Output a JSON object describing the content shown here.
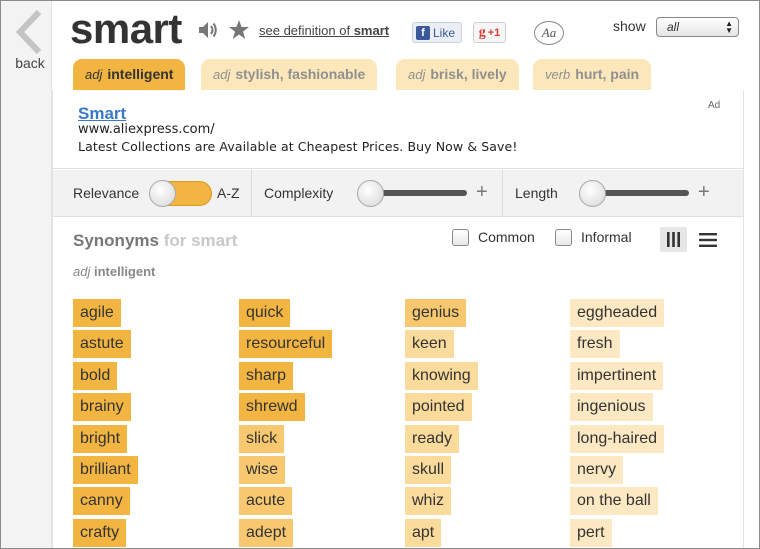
{
  "nav": {
    "back_label": "back"
  },
  "header": {
    "word": "smart",
    "see_definition_prefix": "see definition of",
    "see_definition_word": "smart",
    "fb_like": "Like",
    "gplus": "+1",
    "font_icon_label": "Aa",
    "show_label": "show",
    "show_value": "all"
  },
  "tabs": [
    {
      "pos": "adj",
      "label": "intelligent",
      "active": true
    },
    {
      "pos": "adj",
      "label": "stylish, fashionable",
      "active": false
    },
    {
      "pos": "adj",
      "label": "brisk, lively",
      "active": false
    },
    {
      "pos": "verb",
      "label": "hurt, pain",
      "active": false
    }
  ],
  "ad": {
    "title": "Smart",
    "url": "www.aliexpress.com/",
    "description": "Latest Collections are Available at Cheapest Prices. Buy Now & Save!",
    "badge": "Ad"
  },
  "filters": {
    "relevance": "Relevance",
    "az": "A-Z",
    "complexity": "Complexity",
    "length": "Length",
    "plus": "+"
  },
  "synonyms": {
    "heading": "Synonyms",
    "heading_sub": "for smart",
    "common_label": "Common",
    "informal_label": "Informal",
    "sense_pos": "adj",
    "sense_def": "intelligent",
    "columns": [
      [
        "agile",
        "astute",
        "bold",
        "brainy",
        "bright",
        "brilliant",
        "canny",
        "crafty"
      ],
      [
        "quick",
        "resourceful",
        "sharp",
        "shrewd",
        "slick",
        "wise",
        "acute",
        "adept"
      ],
      [
        "genius",
        "keen",
        "knowing",
        "pointed",
        "ready",
        "skull",
        "whiz",
        "apt"
      ],
      [
        "eggheaded",
        "fresh",
        "impertinent",
        "ingenious",
        "long-haired",
        "nervy",
        "on the ball",
        "pert"
      ]
    ]
  },
  "colors": {
    "relevance_1": "#f3b541",
    "relevance_2": "#f7c870",
    "relevance_3": "#fadb9c",
    "relevance_4": "#fce8c2",
    "link": "#3b79c8"
  }
}
